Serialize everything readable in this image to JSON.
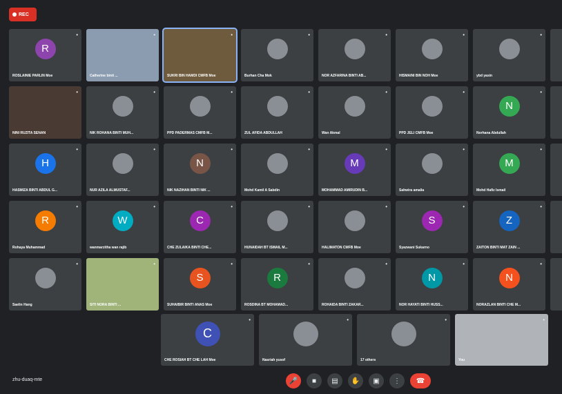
{
  "rec_label": "REC",
  "rows": [
    [
      {
        "name": "ROSLAINIE PARLIN Moe",
        "initial": "R",
        "color": "#8e44ad",
        "type": "avatar"
      },
      {
        "name": "Catherine binti ...",
        "type": "photo",
        "bg": "#8c9cb0"
      },
      {
        "name": "SUKRI BIN HAMDI CMFB Moe",
        "type": "photo",
        "bg": "#6e5a3c",
        "highlight": true
      },
      {
        "name": "Burhan Cha Mok",
        "type": "pic"
      },
      {
        "name": "NOR AZFARINA BINTI AB...",
        "type": "pic"
      },
      {
        "name": "HISMAINI BIN NOH Moe",
        "type": "pic"
      },
      {
        "name": "ybd yasin",
        "type": "pic"
      }
    ],
    [
      {
        "name": "NINI RUZITA SENAN",
        "type": "photo",
        "bg": "#4a3a34"
      },
      {
        "name": "NIK ROHANA BINTI MUH...",
        "type": "pic"
      },
      {
        "name": "PPD PADERMAS CMFB M...",
        "type": "pic"
      },
      {
        "name": "ZUL AFIDA ABDULLAH",
        "type": "pic"
      },
      {
        "name": "Wan Akmal",
        "type": "pic"
      },
      {
        "name": "PPD JELI CMFB Moe",
        "type": "pic"
      },
      {
        "name": "Norhana Abdullah",
        "initial": "N",
        "color": "#34a853",
        "type": "avatar"
      }
    ],
    [
      {
        "name": "HASMIZA BINTI ABDUL G...",
        "initial": "H",
        "color": "#1a73e8",
        "type": "avatar"
      },
      {
        "name": "NUR AZILA ALMUSTAF...",
        "type": "pic"
      },
      {
        "name": "NIK NAZIHAN BINTI NIK ...",
        "initial": "N",
        "color": "#795548",
        "type": "avatar"
      },
      {
        "name": "Mohd Kamil A Sabdin",
        "type": "pic"
      },
      {
        "name": "MOHAMMAD AMIRUDIN B...",
        "initial": "M",
        "color": "#673ab7",
        "type": "avatar"
      },
      {
        "name": "Sahwira amalia",
        "type": "pic"
      },
      {
        "name": "Mohd Hafiz Ismail",
        "initial": "M",
        "color": "#34a853",
        "type": "avatar"
      }
    ],
    [
      {
        "name": "Rohaya Muhammad",
        "initial": "R",
        "color": "#f57c00",
        "type": "avatar"
      },
      {
        "name": "wanmarzitha wan rajib",
        "initial": "W",
        "color": "#00acc1",
        "type": "avatar"
      },
      {
        "name": "CHE ZULAIKA BINTI CHE...",
        "initial": "C",
        "color": "#9c27b0",
        "type": "avatar"
      },
      {
        "name": "HUNAIDAH BT ISMAIL M...",
        "type": "pic"
      },
      {
        "name": "HALIMATON CMFB Moe",
        "type": "pic"
      },
      {
        "name": "Syazwani Sukarno",
        "initial": "S",
        "color": "#9c27b0",
        "type": "avatar"
      },
      {
        "name": "ZAITON BINTI MAT ZAIN ...",
        "initial": "Z",
        "color": "#1565c0",
        "type": "avatar"
      }
    ],
    [
      {
        "name": "Saelin Hang",
        "type": "pic"
      },
      {
        "name": "SITI NORA BINTI ...",
        "type": "photo",
        "bg": "#a0b47a"
      },
      {
        "name": "SUHAIBIR BINTI ANAS Moe",
        "initial": "S",
        "color": "#e8541f",
        "type": "avatar"
      },
      {
        "name": "ROSDINA BT MOHAMAD...",
        "initial": "R",
        "color": "#1b7a3e",
        "type": "avatar"
      },
      {
        "name": "ROHAIDA BINTI ZAKAR...",
        "type": "pic"
      },
      {
        "name": "NOR HAYATI BINTI HUSS...",
        "initial": "N",
        "color": "#0097a7",
        "type": "avatar"
      },
      {
        "name": "NORAZLAN BINTI CHE M...",
        "initial": "N",
        "color": "#f4511e",
        "type": "avatar"
      }
    ]
  ],
  "bottom": [
    {
      "name": "CHE ROSIAH BT CHE LAH Moe",
      "initial": "C",
      "color": "#3f51b5",
      "type": "avatar"
    },
    {
      "name": "Nasriah yusof",
      "type": "pic"
    },
    {
      "name": "17 others",
      "type": "pic"
    },
    {
      "name": "You",
      "type": "photo",
      "bg": "#b0b3b8"
    }
  ],
  "meeting_code": "zhu-duaq-mte",
  "controls": [
    "mic-off",
    "camera",
    "captions",
    "raise-hand",
    "present",
    "more",
    "end-call"
  ],
  "colors": {
    "background": "#202124",
    "tile": "#3c4043",
    "red": "#ea4335"
  }
}
